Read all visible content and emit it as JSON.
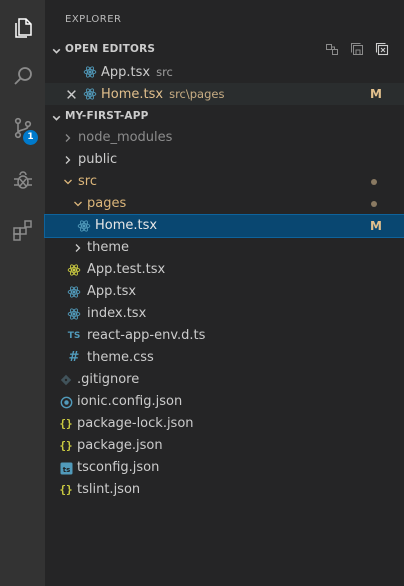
{
  "activity_bar": {
    "items": [
      {
        "name": "explorer",
        "icon": "files-icon"
      },
      {
        "name": "search",
        "icon": "search-icon"
      },
      {
        "name": "source-control",
        "icon": "source-control-icon",
        "badge": "1"
      },
      {
        "name": "debug",
        "icon": "debug-icon"
      },
      {
        "name": "extensions",
        "icon": "extensions-icon"
      }
    ]
  },
  "explorer": {
    "title": "EXPLORER",
    "open_editors": {
      "label": "OPEN EDITORS",
      "items": [
        {
          "name": "App.tsx",
          "path": "src",
          "icon": "react-icon"
        },
        {
          "name": "Home.tsx",
          "path": "src\\pages",
          "status": "M",
          "icon": "react-icon"
        }
      ]
    },
    "project": {
      "label": "MY-FIRST-APP",
      "items": [
        {
          "name": "node_modules",
          "type": "folder"
        },
        {
          "name": "public",
          "type": "folder"
        },
        {
          "name": "src",
          "type": "folder"
        },
        {
          "name": "pages",
          "type": "folder"
        },
        {
          "name": "Home.tsx",
          "status": "M",
          "icon": "react-icon"
        },
        {
          "name": "theme",
          "type": "folder"
        },
        {
          "name": "App.test.tsx",
          "icon": "react-test-icon"
        },
        {
          "name": "App.tsx",
          "icon": "react-icon"
        },
        {
          "name": "index.tsx",
          "icon": "react-icon"
        },
        {
          "name": "react-app-env.d.ts",
          "icon": "ts-icon",
          "icon_text": "TS"
        },
        {
          "name": "theme.css",
          "icon": "css-icon",
          "icon_text": "#"
        },
        {
          "name": ".gitignore",
          "icon": "git-icon"
        },
        {
          "name": "ionic.config.json",
          "icon": "ionic-icon"
        },
        {
          "name": "package-lock.json",
          "icon": "json-icon",
          "icon_text": "{}"
        },
        {
          "name": "package.json",
          "icon": "json-icon",
          "icon_text": "{}"
        },
        {
          "name": "tsconfig.json",
          "icon": "tsconfig-icon"
        },
        {
          "name": "tslint.json",
          "icon": "json-icon",
          "icon_text": "{}"
        }
      ]
    }
  },
  "colors": {
    "activity_bar": "#333333",
    "sidebar": "#252526",
    "selection": "#094771",
    "modified": "#e2c08d",
    "react": "#519aba",
    "badge": "#007acc"
  }
}
